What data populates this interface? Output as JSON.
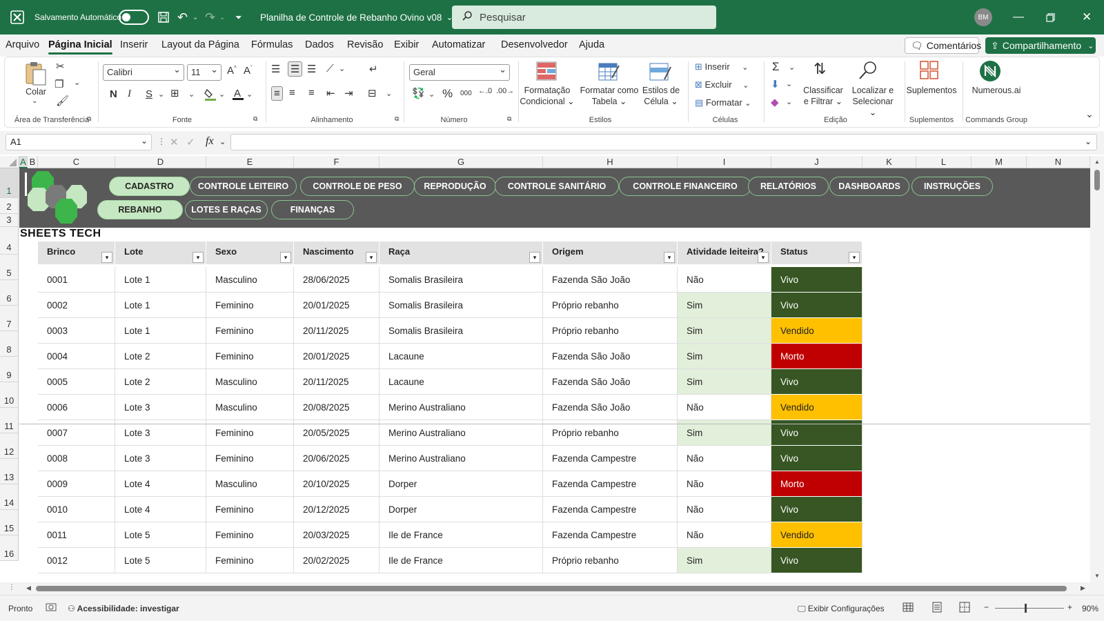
{
  "titlebar": {
    "autosave_label": "Salvamento Automático",
    "file_title": "Planilha de Controle de Rebanho Ovino v08",
    "search_placeholder": "Pesquisar",
    "avatar": "BM"
  },
  "menu": {
    "items": [
      "Arquivo",
      "Página Inicial",
      "Inserir",
      "Layout da Página",
      "Fórmulas",
      "Dados",
      "Revisão",
      "Exibir",
      "Automatizar",
      "Desenvolvedor",
      "Ajuda"
    ],
    "comments": "Comentários",
    "share": "Compartilhamento"
  },
  "ribbon": {
    "clipboard": {
      "paste": "Colar",
      "group": "Área de Transferência"
    },
    "font": {
      "name": "Calibri",
      "size": "11",
      "bold": "N",
      "italic": "I",
      "underline": "S",
      "group": "Fonte"
    },
    "alignment": {
      "group": "Alinhamento"
    },
    "number": {
      "format": "Geral",
      "group": "Número"
    },
    "styles": {
      "conditional": [
        "Formatação",
        "Condicional"
      ],
      "table": [
        "Formatar como",
        "Tabela"
      ],
      "cell": [
        "Estilos de",
        "Célula"
      ],
      "group": "Estilos"
    },
    "cells": {
      "insert": "Inserir",
      "delete": "Excluir",
      "format": "Formatar",
      "group": "Células"
    },
    "editing": {
      "sort": [
        "Classificar",
        "e Filtrar"
      ],
      "find": [
        "Localizar e",
        "Selecionar"
      ],
      "group": "Edição"
    },
    "addins": {
      "label": "Suplementos",
      "group": "Suplementos"
    },
    "commands": {
      "label": "Numerous.ai",
      "group": "Commands Group"
    }
  },
  "formula_bar": {
    "name_box": "A1",
    "fx": "fx"
  },
  "columns": [
    "A",
    "B",
    "C",
    "D",
    "E",
    "F",
    "G",
    "H",
    "I",
    "J",
    "K",
    "L",
    "M",
    "N"
  ],
  "rows": [
    "1",
    "2",
    "3",
    "4",
    "5",
    "6",
    "7",
    "8",
    "9",
    "10",
    "11",
    "12",
    "13",
    "14",
    "15",
    "16"
  ],
  "nav": {
    "row1": [
      "CADASTRO",
      "CONTROLE LEITEIRO",
      "CONTROLE DE PESO",
      "REPRODUÇÃO",
      "CONTROLE SANITÁRIO",
      "CONTROLE FINANCEIRO",
      "RELATÓRIOS",
      "DASHBOARDS",
      "INSTRUÇÕES"
    ],
    "row2": [
      "REBANHO",
      "LOTES E RAÇAS",
      "FINANÇAS"
    ]
  },
  "brand": "SHEETS TECH",
  "table": {
    "headers": [
      "Brinco",
      "Lote",
      "Sexo",
      "Nascimento",
      "Raça",
      "Origem",
      "Atividade leiteira?",
      "Status"
    ],
    "rows": [
      [
        "0001",
        "Lote 1",
        "Masculino",
        "28/06/2025",
        "Somalis Brasileira",
        "Fazenda São João",
        "Não",
        "Vivo"
      ],
      [
        "0002",
        "Lote 1",
        "Feminino",
        "20/01/2025",
        "Somalis Brasileira",
        "Próprio rebanho",
        "Sim",
        "Vivo"
      ],
      [
        "0003",
        "Lote 1",
        "Feminino",
        "20/11/2025",
        "Somalis Brasileira",
        "Próprio rebanho",
        "Sim",
        "Vendido"
      ],
      [
        "0004",
        "Lote 2",
        "Feminino",
        "20/01/2025",
        "Lacaune",
        "Fazenda São João",
        "Sim",
        "Morto"
      ],
      [
        "0005",
        "Lote 2",
        "Masculino",
        "20/11/2025",
        "Lacaune",
        "Fazenda São João",
        "Sim",
        "Vivo"
      ],
      [
        "0006",
        "Lote 3",
        "Masculino",
        "20/08/2025",
        "Merino Australiano",
        "Fazenda São João",
        "Não",
        "Vendido"
      ],
      [
        "0007",
        "Lote 3",
        "Feminino",
        "20/05/2025",
        "Merino Australiano",
        "Próprio rebanho",
        "Sim",
        "Vivo"
      ],
      [
        "0008",
        "Lote 3",
        "Feminino",
        "20/06/2025",
        "Merino Australiano",
        "Fazenda Campestre",
        "Não",
        "Vivo"
      ],
      [
        "0009",
        "Lote 4",
        "Masculino",
        "20/10/2025",
        "Dorper",
        "Fazenda Campestre",
        "Não",
        "Morto"
      ],
      [
        "0010",
        "Lote 4",
        "Feminino",
        "20/12/2025",
        "Dorper",
        "Fazenda Campestre",
        "Não",
        "Vivo"
      ],
      [
        "0011",
        "Lote 5",
        "Feminino",
        "20/03/2025",
        "Ile de France",
        "Fazenda Campestre",
        "Não",
        "Vendido"
      ],
      [
        "0012",
        "Lote 5",
        "Feminino",
        "20/02/2025",
        "Ile de France",
        "Próprio rebanho",
        "Sim",
        "Vivo"
      ]
    ]
  },
  "status_colors": {
    "Vivo": "#375623",
    "Vendido": "#ffc000",
    "Morto": "#c00000",
    "Sim": "#e2efda"
  },
  "statusbar": {
    "ready": "Pronto",
    "accessibility": "Acessibilidade: investigar",
    "display_settings": "Exibir Configurações",
    "zoom": "90%"
  }
}
